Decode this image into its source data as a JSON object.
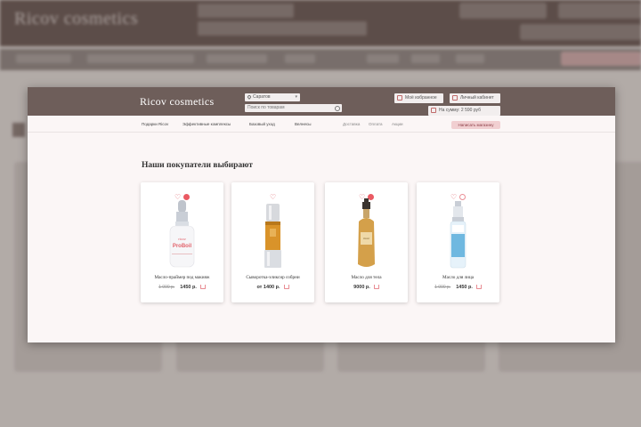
{
  "background": {
    "logo": "Ricov cosmetics"
  },
  "modal": {
    "header": {
      "logo": "Ricov cosmetics",
      "city_label": "Саратов",
      "search_placeholder": "Поиск по товарам",
      "favorites_label": "Моё избранное",
      "cabinet_label": "Личный кабинет",
      "cart_label": "На сумму: 2 590 руб"
    },
    "nav": {
      "items": [
        "Подарки Ricov",
        "Эффективные комплексы",
        "Базовый уход",
        "Велнесы"
      ],
      "secondary": [
        "Доставка",
        "Оплата",
        "Акции"
      ],
      "help_button": "Написать магазину"
    },
    "section_title": "Наши покупатели выбирают",
    "products": [
      {
        "name": "Масло-праймер под макияж",
        "old_price": "1 090 р.",
        "price": "1450 р.",
        "in_compare": true,
        "bottle": "dropper-white"
      },
      {
        "name": "Сыворотка-эликсир собрни",
        "old_price": "",
        "price": "от 1400 р.",
        "in_compare": false,
        "bottle": "pump-gold"
      },
      {
        "name": "Масло для тела",
        "old_price": "",
        "price": "9000 р.",
        "in_compare": true,
        "bottle": "pump-amber"
      },
      {
        "name": "Масло для лица",
        "old_price": "1 090 р.",
        "price": "1450 р.",
        "in_compare": false,
        "bottle": "pump-blue"
      }
    ]
  },
  "colors": {
    "header_bg": "#6e5e5a",
    "accent": "#ea5a63",
    "help_bg": "#f1cfd1"
  }
}
